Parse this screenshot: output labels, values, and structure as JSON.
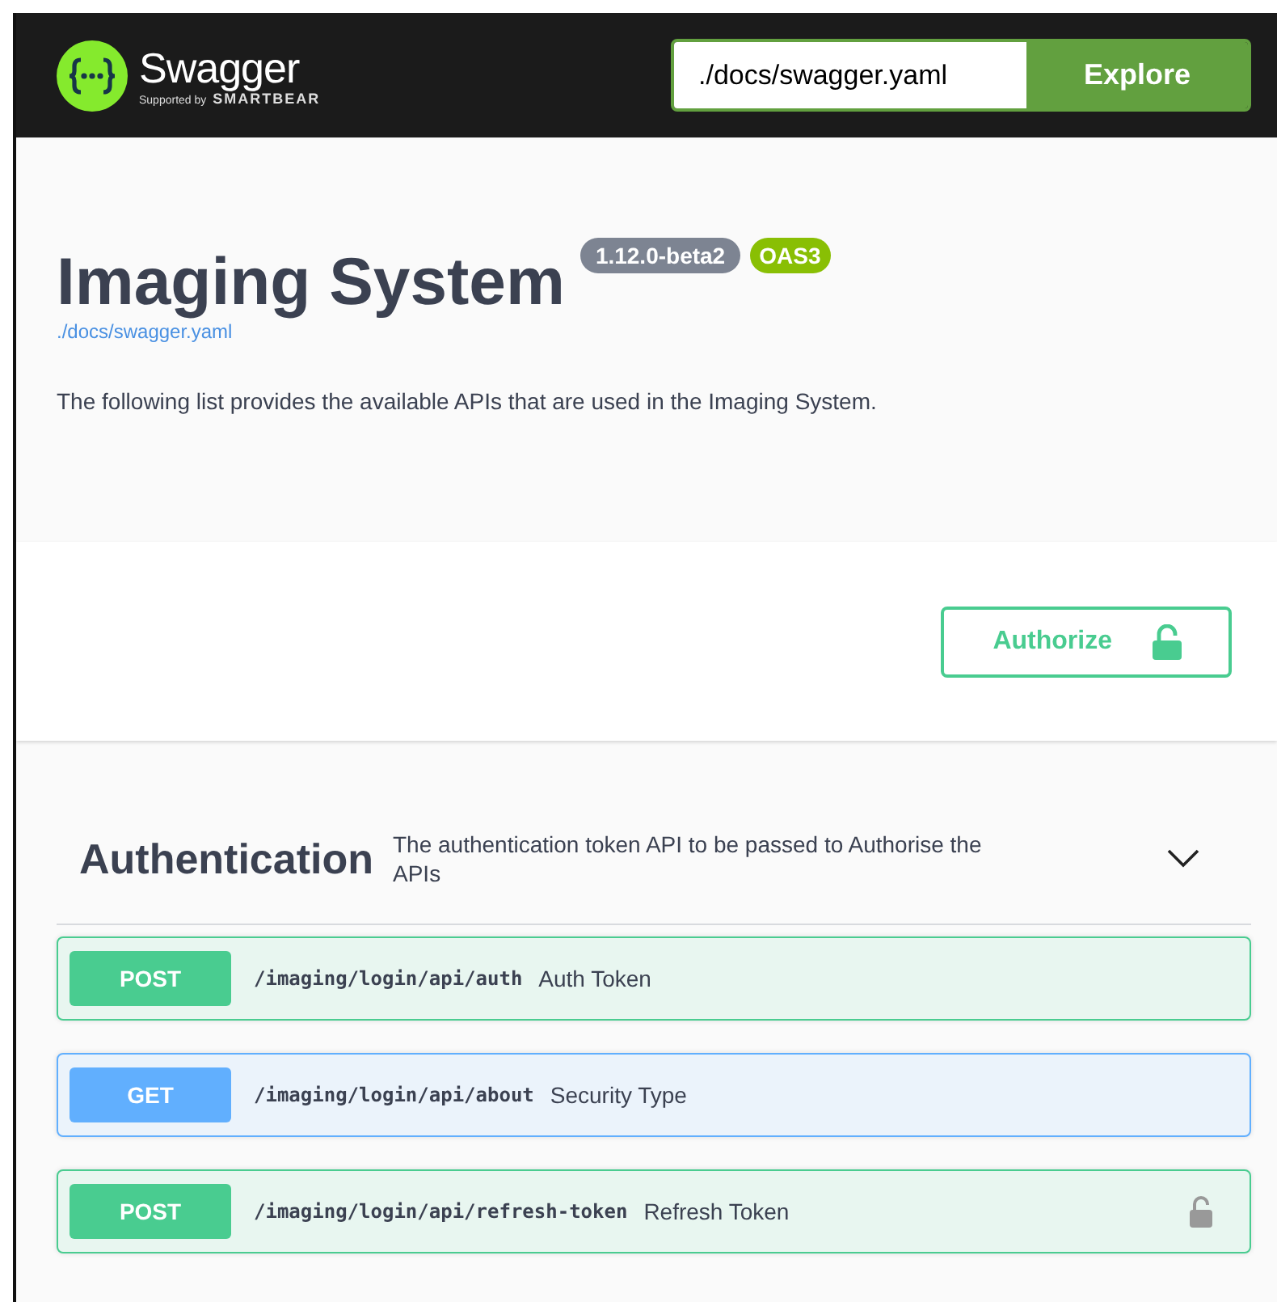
{
  "topbar": {
    "logo_text": "Swagger",
    "logo_sub": "Supported by",
    "logo_brand": "SMARTBEAR",
    "url_value": "./docs/swagger.yaml",
    "explore_label": "Explore"
  },
  "info": {
    "title": "Imaging System",
    "version": "1.12.0-beta2",
    "oas": "OAS3",
    "spec_link": "./docs/swagger.yaml",
    "description": "The following list provides the available APIs that are used in the Imaging System."
  },
  "authorize": {
    "label": "Authorize"
  },
  "sections": [
    {
      "name": "Authentication",
      "description": "The authentication token API to be passed to Authorise the APIs",
      "expanded": true,
      "operations": [
        {
          "method": "POST",
          "path": "/imaging/login/api/auth",
          "summary": "Auth Token",
          "secured": false
        },
        {
          "method": "GET",
          "path": "/imaging/login/api/about",
          "summary": "Security Type",
          "secured": false
        },
        {
          "method": "POST",
          "path": "/imaging/login/api/refresh-token",
          "summary": "Refresh Token",
          "secured": true
        }
      ]
    }
  ]
}
